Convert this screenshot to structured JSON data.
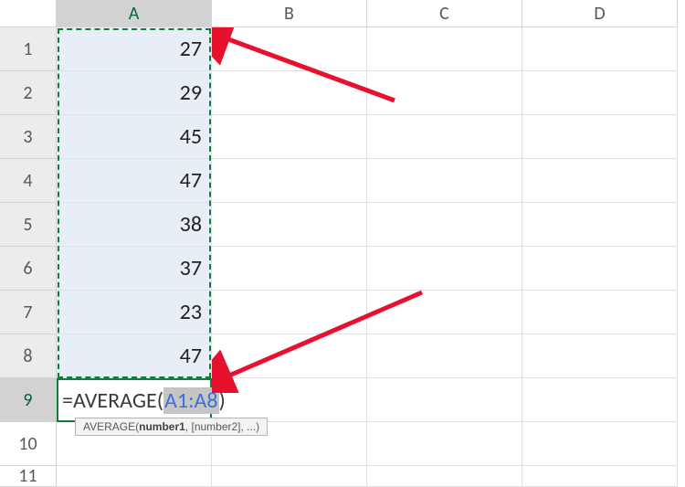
{
  "columns": {
    "A": "A",
    "B": "B",
    "C": "C",
    "D": "D"
  },
  "rows": {
    "r1": "1",
    "r2": "2",
    "r3": "3",
    "r4": "4",
    "r5": "5",
    "r6": "6",
    "r7": "7",
    "r8": "8",
    "r9": "9",
    "r10": "10",
    "r11": "11"
  },
  "values": {
    "a1": "27",
    "a2": "29",
    "a3": "45",
    "a4": "47",
    "a5": "38",
    "a6": "37",
    "a7": "23",
    "a8": "47"
  },
  "formula": {
    "eq": "=",
    "fn": "AVERAGE(",
    "ref": "A1:A8",
    "close": ")"
  },
  "tooltip": {
    "prefix": "AVERAGE(",
    "bold": "number1",
    "rest": ", [number2], ...)"
  },
  "chart_data": {
    "type": "table",
    "title": "Excel AVERAGE formula over A1:A8",
    "columns": [
      "A"
    ],
    "rows": [
      {
        "row": 1,
        "A": 27
      },
      {
        "row": 2,
        "A": 29
      },
      {
        "row": 3,
        "A": 45
      },
      {
        "row": 4,
        "A": 47
      },
      {
        "row": 5,
        "A": 38
      },
      {
        "row": 6,
        "A": 37
      },
      {
        "row": 7,
        "A": 23
      },
      {
        "row": 8,
        "A": 47
      }
    ],
    "formula_cell": {
      "cell": "A9",
      "formula": "=AVERAGE(A1:A8)"
    }
  }
}
